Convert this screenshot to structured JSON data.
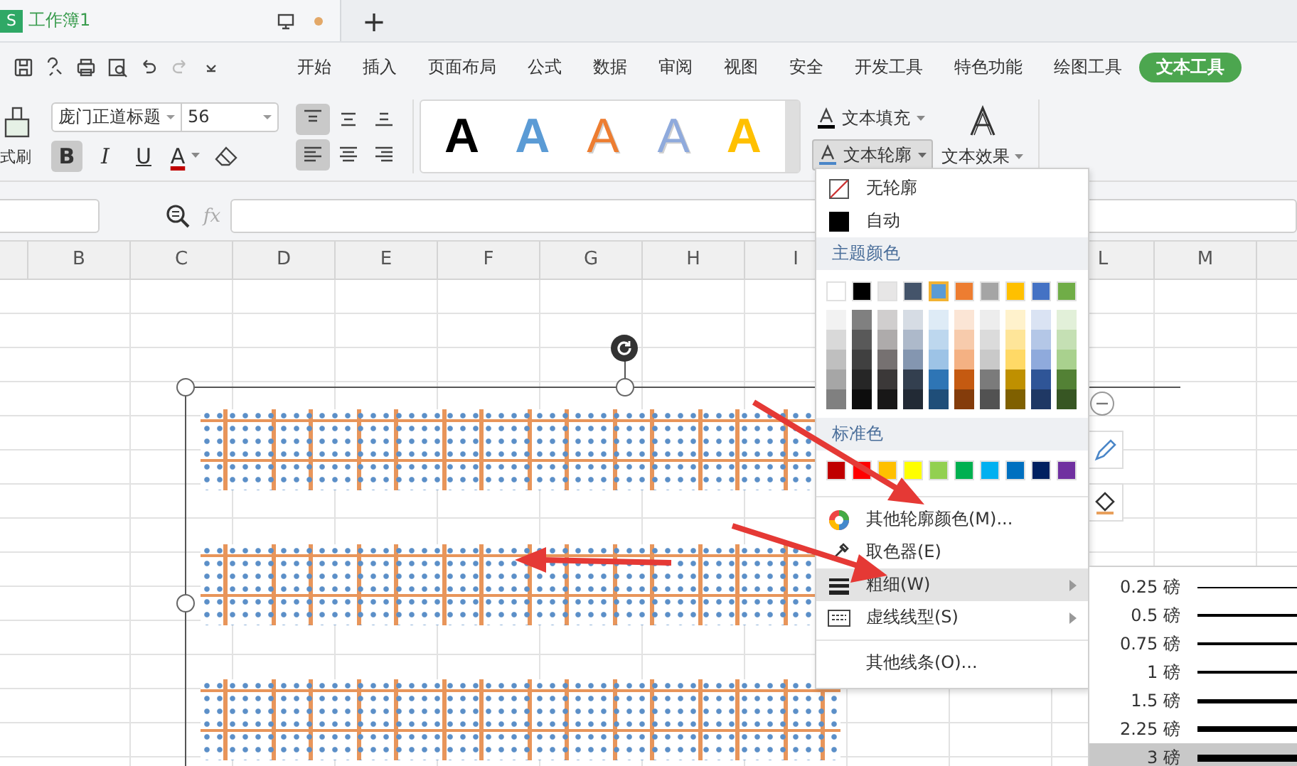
{
  "tab": {
    "app_icon": "S",
    "title": "工作簿1",
    "unsaved": true
  },
  "new_tab": "+",
  "menu_tabs": [
    {
      "label": "开始",
      "selected": false
    },
    {
      "label": "插入",
      "selected": false
    },
    {
      "label": "页面布局",
      "selected": false
    },
    {
      "label": "公式",
      "selected": false
    },
    {
      "label": "数据",
      "selected": false
    },
    {
      "label": "审阅",
      "selected": false
    },
    {
      "label": "视图",
      "selected": false
    },
    {
      "label": "安全",
      "selected": false
    },
    {
      "label": "开发工具",
      "selected": false
    },
    {
      "label": "特色功能",
      "selected": false
    },
    {
      "label": "绘图工具",
      "selected": false
    },
    {
      "label": "文本工具",
      "selected": true
    }
  ],
  "ribbon": {
    "format_painter": "式刷",
    "font_name": "庞门正道标题",
    "font_size": "56",
    "text_buttons": [
      {
        "kind": "bold",
        "label": "B",
        "on": true
      },
      {
        "kind": "italic",
        "label": "I",
        "on": false
      },
      {
        "kind": "underline",
        "label": "U",
        "on": false
      },
      {
        "kind": "font-color",
        "label": "A",
        "on": false
      }
    ],
    "vertical_align": [
      {
        "kind": "top",
        "selected": true
      },
      {
        "kind": "middle",
        "selected": false
      },
      {
        "kind": "bottom",
        "selected": false
      }
    ],
    "horizontal_align": [
      {
        "kind": "left",
        "selected": true
      },
      {
        "kind": "center",
        "selected": false
      },
      {
        "kind": "right",
        "selected": false
      }
    ],
    "style_presets": [
      {
        "label": "A",
        "kind": "solid",
        "color": "#000000"
      },
      {
        "label": "A",
        "kind": "solid",
        "color": "#5b9bd5"
      },
      {
        "label": "A",
        "kind": "outline",
        "color": "#ed7d31"
      },
      {
        "label": "A",
        "kind": "outline",
        "color": "#8faadc"
      },
      {
        "label": "A",
        "kind": "solid",
        "color": "#ffc000"
      }
    ],
    "text_fill": "文本填充",
    "text_outline": {
      "label": "文本轮廓",
      "open": true
    },
    "text_effect": "文本效果"
  },
  "formula_bar": {
    "fx": "fx"
  },
  "columns": [
    "B",
    "C",
    "D",
    "E",
    "F",
    "G",
    "H",
    "I",
    "L",
    "M"
  ],
  "outline_menu": {
    "no_outline": "无轮廓",
    "auto": "自动",
    "theme_header": "主题颜色",
    "theme_colors": [
      {
        "color": "#ffffff",
        "selected": false
      },
      {
        "color": "#000000",
        "selected": false
      },
      {
        "color": "#e7e6e6",
        "selected": false
      },
      {
        "color": "#44546a",
        "selected": false
      },
      {
        "color": "#5b9bd5",
        "selected": true
      },
      {
        "color": "#ed7d31",
        "selected": false
      },
      {
        "color": "#a5a5a5",
        "selected": false
      },
      {
        "color": "#ffc000",
        "selected": false
      },
      {
        "color": "#4472c4",
        "selected": false
      },
      {
        "color": "#70ad47",
        "selected": false
      }
    ],
    "shades": [
      [
        {
          "color": "#f2f2f2"
        },
        {
          "color": "#808080"
        },
        {
          "color": "#d0cece"
        },
        {
          "color": "#d6dce4"
        },
        {
          "color": "#deebf6"
        },
        {
          "color": "#fbe5d5"
        },
        {
          "color": "#ededed"
        },
        {
          "color": "#fff2cc"
        },
        {
          "color": "#dae3f3"
        },
        {
          "color": "#e2f0d9"
        }
      ],
      [
        {
          "color": "#d9d9d9"
        },
        {
          "color": "#595959"
        },
        {
          "color": "#aeabab"
        },
        {
          "color": "#adb9ca"
        },
        {
          "color": "#bdd7ee"
        },
        {
          "color": "#f7cbac"
        },
        {
          "color": "#dbdbdb"
        },
        {
          "color": "#fee599"
        },
        {
          "color": "#b4c7e7"
        },
        {
          "color": "#c5e0b4"
        }
      ],
      [
        {
          "color": "#bfbfbf"
        },
        {
          "color": "#404040"
        },
        {
          "color": "#767171"
        },
        {
          "color": "#8496b0"
        },
        {
          "color": "#9dc3e6"
        },
        {
          "color": "#f4b183"
        },
        {
          "color": "#c9c9c9"
        },
        {
          "color": "#ffd966"
        },
        {
          "color": "#8faadc"
        },
        {
          "color": "#a9d18e"
        }
      ],
      [
        {
          "color": "#a6a6a6"
        },
        {
          "color": "#262626"
        },
        {
          "color": "#3b3838"
        },
        {
          "color": "#333f4f"
        },
        {
          "color": "#2e75b5"
        },
        {
          "color": "#c55a11"
        },
        {
          "color": "#7b7b7b"
        },
        {
          "color": "#bf9000"
        },
        {
          "color": "#2f5597"
        },
        {
          "color": "#538135"
        }
      ],
      [
        {
          "color": "#808080"
        },
        {
          "color": "#0d0d0d"
        },
        {
          "color": "#181717"
        },
        {
          "color": "#222a35"
        },
        {
          "color": "#1f4e79"
        },
        {
          "color": "#843c0b"
        },
        {
          "color": "#525252"
        },
        {
          "color": "#7f6000"
        },
        {
          "color": "#1f3864"
        },
        {
          "color": "#375623"
        }
      ]
    ],
    "standard_header": "标准色",
    "standard_colors": [
      {
        "color": "#c00000"
      },
      {
        "color": "#ff0000"
      },
      {
        "color": "#ffc000"
      },
      {
        "color": "#ffff00"
      },
      {
        "color": "#92d050"
      },
      {
        "color": "#00b050"
      },
      {
        "color": "#00b0f0"
      },
      {
        "color": "#0070c0"
      },
      {
        "color": "#002060"
      },
      {
        "color": "#7030a0"
      }
    ],
    "items": [
      {
        "kind": "more-colors",
        "label": "其他轮廓颜色(M)...",
        "highlighted": false,
        "submenu": false
      },
      {
        "kind": "picker",
        "label": "取色器(E)",
        "highlighted": false,
        "submenu": false
      },
      {
        "kind": "weight",
        "label": "粗细(W)",
        "highlighted": true,
        "submenu": true
      },
      {
        "kind": "dash",
        "label": "虚线线型(S)",
        "highlighted": false,
        "submenu": true
      },
      {
        "kind": "more-lines",
        "label": "其他线条(O)...",
        "highlighted": false,
        "submenu": false
      }
    ]
  },
  "weight_submenu": [
    {
      "label": "0.25 磅",
      "selected": false
    },
    {
      "label": "0.5 磅",
      "selected": false
    },
    {
      "label": "0.75 磅",
      "selected": false
    },
    {
      "label": "1 磅",
      "selected": false
    },
    {
      "label": "1.5 磅",
      "selected": false
    },
    {
      "label": "2.25 磅",
      "selected": false
    },
    {
      "label": "3 磅",
      "selected": true
    }
  ]
}
